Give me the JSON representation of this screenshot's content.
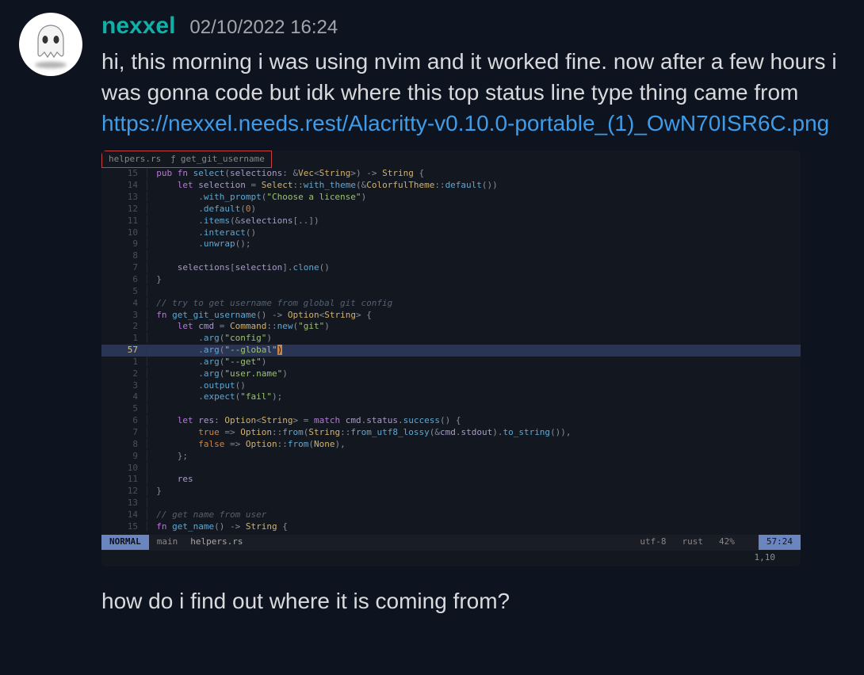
{
  "author": {
    "name": "nexxel",
    "timestamp": "02/10/2022 16:24"
  },
  "body1": "hi, this morning i was using nvim and it worked fine. now after a few hours i was gonna code but idk where this top status line type thing came from",
  "link": "https://nexxel.needs.rest/Alacritty-v0.10.0-portable_(1)_OwN70ISR6C.png",
  "body2": "how do i find out where it is coming from?",
  "breadcrumb": {
    "file": "helpers.rs",
    "glyph": "",
    "symbol": "ƒ",
    "fn": "get_git_username"
  },
  "code": {
    "lines": [
      {
        "rel": "15",
        "html": "<span class='kw'>pub fn</span> <span class='fnname'>select</span><span class='punc'>(</span><span class='ident'>selections</span><span class='punc'>:</span> <span class='op'>&</span><span class='type'>Vec</span><span class='punc'>&lt;</span><span class='type'>String</span><span class='punc'>&gt;) -&gt; </span><span class='type'>String</span> <span class='punc'>{</span>"
      },
      {
        "rel": "14",
        "html": "    <span class='kw'>let</span> <span class='ident'>selection</span> <span class='op'>=</span> <span class='type'>Select</span><span class='punc'>::</span><span class='fnname'>with_theme</span><span class='punc'>(</span><span class='op'>&</span><span class='type'>ColorfulTheme</span><span class='punc'>::</span><span class='fnname'>default</span><span class='punc'>())</span>"
      },
      {
        "rel": "13",
        "html": "        <span class='punc'>.</span><span class='fnname'>with_prompt</span><span class='punc'>(</span><span class='str'>\"Choose a license\"</span><span class='punc'>)</span>"
      },
      {
        "rel": "12",
        "html": "        <span class='punc'>.</span><span class='fnname'>default</span><span class='punc'>(</span><span class='num'>0</span><span class='punc'>)</span>"
      },
      {
        "rel": "11",
        "html": "        <span class='punc'>.</span><span class='fnname'>items</span><span class='punc'>(</span><span class='op'>&</span><span class='ident'>selections</span><span class='punc'>[..])</span>"
      },
      {
        "rel": "10",
        "html": "        <span class='punc'>.</span><span class='fnname'>interact</span><span class='punc'>()</span>"
      },
      {
        "rel": "9",
        "html": "        <span class='punc'>.</span><span class='fnname'>unwrap</span><span class='punc'>();</span>"
      },
      {
        "rel": "8",
        "html": ""
      },
      {
        "rel": "7",
        "html": "    <span class='ident'>selections</span><span class='punc'>[</span><span class='ident'>selection</span><span class='punc'>].</span><span class='fnname'>clone</span><span class='punc'>()</span>"
      },
      {
        "rel": "6",
        "html": "<span class='punc'>}</span>"
      },
      {
        "rel": "5",
        "html": ""
      },
      {
        "rel": "4",
        "html": "<span class='comment'>// try to get username from global git config</span>"
      },
      {
        "rel": "3",
        "html": "<span class='kw'>fn</span> <span class='fnname'>get_git_username</span><span class='punc'>() -&gt; </span><span class='type'>Option</span><span class='punc'>&lt;</span><span class='type'>String</span><span class='punc'>&gt; {</span>"
      },
      {
        "rel": "2",
        "html": "    <span class='kw'>let</span> <span class='ident'>cmd</span> <span class='op'>=</span> <span class='type'>Command</span><span class='punc'>::</span><span class='fnname'>new</span><span class='punc'>(</span><span class='str'>\"git\"</span><span class='punc'>)</span>"
      },
      {
        "rel": "1",
        "html": "        <span class='punc'>.</span><span class='fnname'>arg</span><span class='punc'>(</span><span class='str'>\"config\"</span><span class='punc'>)</span>"
      },
      {
        "abs": "57",
        "hl": true,
        "sign": "",
        "html": "        <span class='punc'>.</span><span class='fnname'>arg</span><span class='punc'>(</span><span class='str'>\"--global\"</span><span style='background:#c8864a;color:#10131a'>)</span>   <span style='color:#556070'></span>"
      },
      {
        "rel": "1",
        "html": "        <span class='punc'>.</span><span class='fnname'>arg</span><span class='punc'>(</span><span class='str'>\"--get\"</span><span class='punc'>)</span>"
      },
      {
        "rel": "2",
        "html": "        <span class='punc'>.</span><span class='fnname'>arg</span><span class='punc'>(</span><span class='str'>\"user.name\"</span><span class='punc'>)</span>"
      },
      {
        "rel": "3",
        "html": "        <span class='punc'>.</span><span class='fnname'>output</span><span class='punc'>()</span>"
      },
      {
        "rel": "4",
        "html": "        <span class='punc'>.</span><span class='fnname'>expect</span><span class='punc'>(</span><span class='str'>\"fail\"</span><span class='punc'>);</span>"
      },
      {
        "rel": "5",
        "html": ""
      },
      {
        "rel": "6",
        "html": "    <span class='kw'>let</span> <span class='ident'>res</span><span class='punc'>:</span> <span class='type'>Option</span><span class='punc'>&lt;</span><span class='type'>String</span><span class='punc'>&gt;</span> <span class='op'>=</span> <span class='kw'>match</span> <span class='ident'>cmd</span><span class='punc'>.</span><span class='ident'>status</span><span class='punc'>.</span><span class='fnname'>success</span><span class='punc'>() {</span>"
      },
      {
        "rel": "7",
        "html": "        <span class='num'>true</span> <span class='op'>=&gt;</span> <span class='type'>Option</span><span class='punc'>::</span><span class='fnname'>from</span><span class='punc'>(</span><span class='type'>String</span><span class='punc'>::</span><span class='fnname'>from_utf8_lossy</span><span class='punc'>(</span><span class='op'>&</span><span class='ident'>cmd</span><span class='punc'>.</span><span class='ident'>stdout</span><span class='punc'>).</span><span class='fnname'>to_string</span><span class='punc'>()),</span>"
      },
      {
        "rel": "8",
        "html": "        <span class='num'>false</span> <span class='op'>=&gt;</span> <span class='type'>Option</span><span class='punc'>::</span><span class='fnname'>from</span><span class='punc'>(</span><span class='type'>None</span><span class='punc'>),</span>"
      },
      {
        "rel": "9",
        "html": "    <span class='punc'>};</span>"
      },
      {
        "rel": "10",
        "html": ""
      },
      {
        "rel": "11",
        "html": "    <span class='ident'>res</span>"
      },
      {
        "rel": "12",
        "html": "<span class='punc'>}</span>"
      },
      {
        "rel": "13",
        "html": ""
      },
      {
        "rel": "14",
        "html": "<span class='comment'>// get name from user</span>"
      },
      {
        "rel": "15",
        "html": "<span class='kw'>fn</span> <span class='fnname'>get_name</span><span class='punc'>() -&gt; </span><span class='type'>String</span> <span class='punc'>{</span>"
      }
    ]
  },
  "statusline": {
    "mode": "NORMAL",
    "branch_glyph": "",
    "branch": "main",
    "file": "helpers.rs",
    "encoding": "utf-8",
    "lang_glyph": "",
    "lang": "rust",
    "percent": "42%",
    "percent_glyph": "",
    "pos": "57:24"
  },
  "cmdline": "1,10"
}
